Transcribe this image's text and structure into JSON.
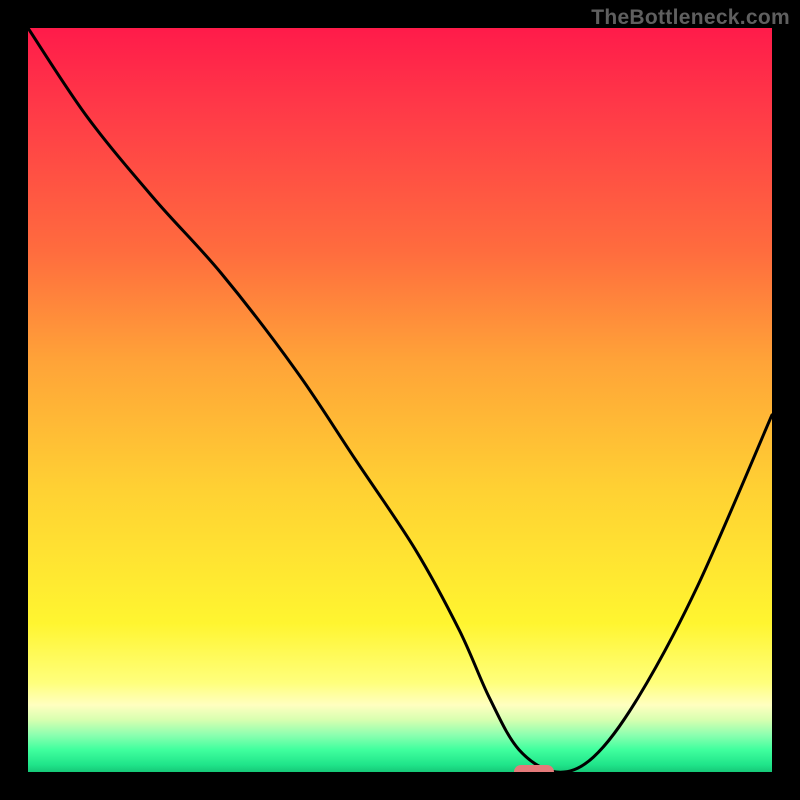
{
  "watermark": "TheBottleneck.com",
  "chart_data": {
    "type": "line",
    "title": "",
    "xlabel": "",
    "ylabel": "",
    "xlim": [
      0,
      100
    ],
    "ylim": [
      0,
      100
    ],
    "grid": false,
    "gradient_stops": [
      {
        "pct": 0,
        "color": "#ff1b4a"
      },
      {
        "pct": 10,
        "color": "#ff3748"
      },
      {
        "pct": 30,
        "color": "#ff6c3e"
      },
      {
        "pct": 45,
        "color": "#ffa438"
      },
      {
        "pct": 62,
        "color": "#ffd133"
      },
      {
        "pct": 80,
        "color": "#fff530"
      },
      {
        "pct": 88,
        "color": "#ffff7c"
      },
      {
        "pct": 91,
        "color": "#ffffc0"
      },
      {
        "pct": 93,
        "color": "#d7ffb0"
      },
      {
        "pct": 95,
        "color": "#8dffb0"
      },
      {
        "pct": 97,
        "color": "#40ff9e"
      },
      {
        "pct": 99,
        "color": "#20e58a"
      },
      {
        "pct": 100,
        "color": "#16c878"
      }
    ],
    "series": [
      {
        "name": "bottleneck-curve",
        "x": [
          0,
          8,
          17,
          26,
          36,
          44,
          52,
          58,
          62,
          66,
          71,
          76,
          82,
          90,
          100
        ],
        "y": [
          100,
          88,
          77,
          67,
          54,
          42,
          30,
          19,
          10,
          3,
          0,
          2,
          10,
          25,
          48
        ]
      }
    ],
    "marker": {
      "x": 68,
      "y": 0,
      "color": "#e47a7a"
    },
    "annotations": []
  }
}
